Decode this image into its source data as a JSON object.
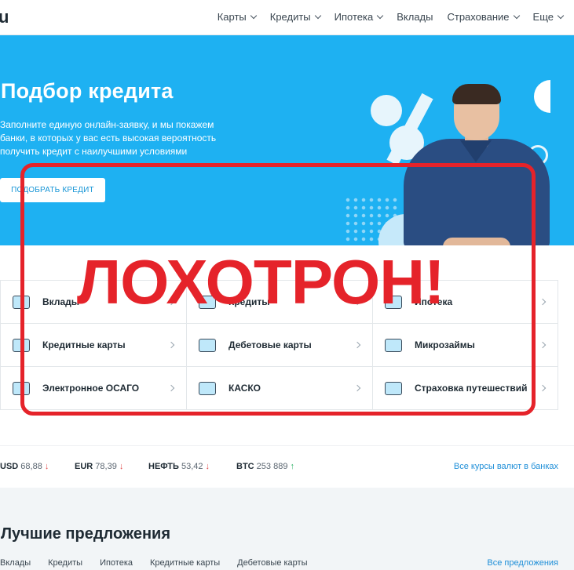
{
  "header": {
    "logo": "u",
    "nav": [
      {
        "label": "Карты",
        "dropdown": true
      },
      {
        "label": "Кредиты",
        "dropdown": true
      },
      {
        "label": "Ипотека",
        "dropdown": true
      },
      {
        "label": "Вклады",
        "dropdown": false
      },
      {
        "label": "Страхование",
        "dropdown": true
      },
      {
        "label": "Еще",
        "dropdown": true
      }
    ]
  },
  "hero": {
    "title": "Подбор кредита",
    "text": "Заполните единую онлайн-заявку, и мы покажем банки, в которых у вас есть высокая вероятность получить кредит с наилучшими условиями",
    "button": "ПОДОБРАТЬ КРЕДИТ",
    "decor_percent": "%"
  },
  "categories": [
    {
      "label": "Вклады",
      "icon": "deposit-icon"
    },
    {
      "label": "Кредиты",
      "icon": "credit-icon"
    },
    {
      "label": "Ипотека",
      "icon": "mortgage-icon"
    },
    {
      "label": "Кредитные карты",
      "icon": "credit-card-icon"
    },
    {
      "label": "Дебетовые карты",
      "icon": "debit-card-icon"
    },
    {
      "label": "Микрозаймы",
      "icon": "microloan-icon"
    },
    {
      "label": "Электронное ОСАГО",
      "icon": "osago-icon"
    },
    {
      "label": "КАСКО",
      "icon": "car-icon"
    },
    {
      "label": "Страховка путешествий",
      "icon": "travel-icon"
    }
  ],
  "stamp": {
    "text": "ЛОХОТРОН!",
    "color": "#e5232a"
  },
  "rates": {
    "items": [
      {
        "code": "USD",
        "value": "68,88",
        "trend": "↓"
      },
      {
        "code": "EUR",
        "value": "78,39",
        "trend": "↓"
      },
      {
        "code": "НЕФТЬ",
        "value": "53,42",
        "trend": "↓"
      },
      {
        "code": "BTC",
        "value": "253 889",
        "trend": "↑"
      }
    ],
    "link": "Все курсы валют в банках"
  },
  "offers": {
    "title": "Лучшие предложения",
    "tabs": [
      "Вклады",
      "Кредиты",
      "Ипотека",
      "Кредитные карты",
      "Дебетовые карты"
    ],
    "link": "Все предложения"
  },
  "colors": {
    "hero_bg": "#1eb1f2",
    "accent_link": "#1f8fd8",
    "trend_down": "#e24b4b",
    "trend_up": "#34b36b"
  }
}
